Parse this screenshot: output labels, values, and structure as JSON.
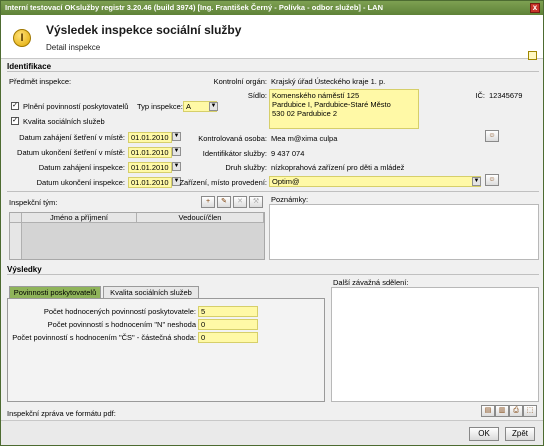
{
  "window": {
    "title": "Interní testovací OKslužby registr 3.20.46 (build 3974)  [Ing. František Černý - Polívka - odbor služeb] - LAN",
    "close_glyph": "x"
  },
  "header": {
    "icon_glyph": "I",
    "title": "Výsledek inspekce sociální služby",
    "subtitle": "Detail inspekce"
  },
  "identifikace": {
    "section_title": "Identifikace",
    "predmet_label": "Předmět inspekce:",
    "plneni_label": "Plnění povinností poskytovatelů",
    "plneni_checked": true,
    "typ_label": "Typ inspekce:",
    "typ_value": "A",
    "kvalita_label": "Kvalita sociálních služeb",
    "kvalita_checked": true,
    "kontrolni_organ_label": "Kontrolní orgán:",
    "kontrolni_organ_value": "Krajský úřad Ústeckého kraje 1. p.",
    "sidlo_label": "Sídlo:",
    "sidlo_lines": [
      "Komenského náměstí 125",
      "Pardubice I, Pardubice-Staré Město",
      "530 02 Pardubice 2"
    ],
    "ic_label": "IČ:",
    "ic_value": "12345679",
    "dates": [
      {
        "label": "Datum zahájení šetření v místě:",
        "value": "01.01.2010"
      },
      {
        "label": "Datum ukončení šetření v místě:",
        "value": "01.01.2010"
      },
      {
        "label": "Datum zahájení inspekce:",
        "value": "01.01.2010"
      },
      {
        "label": "Datum ukončení inspekce:",
        "value": "01.01.2010"
      }
    ],
    "kontrolovana_osoba_label": "Kontrolovaná osoba:",
    "kontrolovana_osoba_value": "Mea m@xima culpa",
    "identifikator_label": "Identifikátor služby:",
    "identifikator_value": "9 437 074",
    "druh_label": "Druh služby:",
    "druh_value": "nízkoprahová zařízení pro děti a mládež",
    "zarizeni_label": "Zařízení, místo provedení:",
    "zarizeni_value": "Optim@",
    "inspekcni_tym_label": "Inspekční tým:",
    "team_columns": [
      "Jméno a příjmení",
      "Vedoucí/člen"
    ],
    "poznamky_label": "Poznámky:"
  },
  "vysledky": {
    "section_title": "Výsledky",
    "tabs": [
      "Povinnosti poskytovatelů",
      "Kvalita sociálních služeb"
    ],
    "rows": [
      {
        "label": "Počet hodnocených povinností poskytovatele:",
        "value": "5"
      },
      {
        "label": "Počet povinností s hodnocením \"N\" neshoda",
        "value": "0"
      },
      {
        "label": "Počet povinností s hodnocením \"ČS\" - částečná shoda:",
        "value": "0"
      }
    ],
    "dalsi_label": "Další závažná sdělení:",
    "inspekcni_zprava_label": "Inspekční zpráva ve formátu pdf:"
  },
  "buttons": {
    "ok": "OK",
    "back": "Zpět"
  },
  "colors": {
    "accent": "#7da052",
    "field_highlight": "#fff9a6"
  }
}
